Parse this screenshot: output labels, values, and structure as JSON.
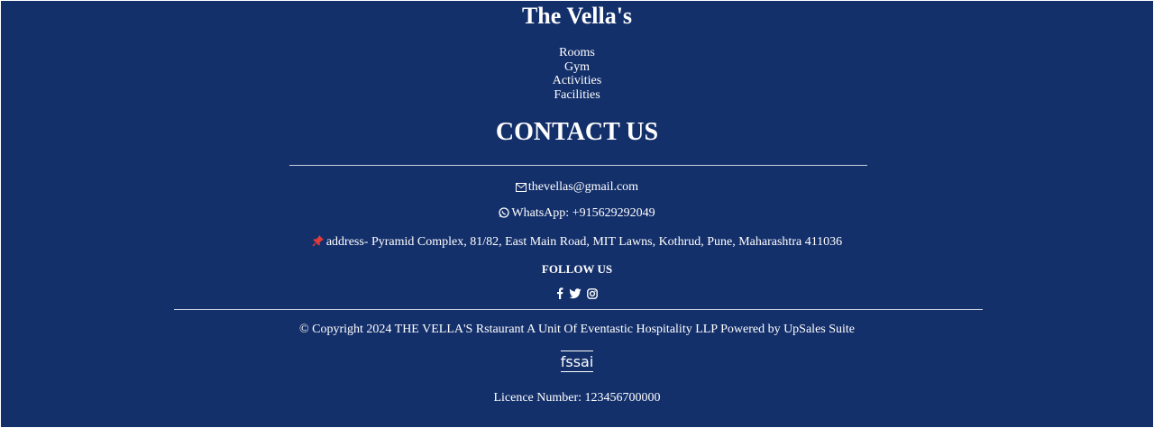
{
  "brand": {
    "name": "The Vella's"
  },
  "nav": {
    "items": [
      "Rooms",
      "Gym",
      "Activities",
      "Facilities"
    ]
  },
  "contact": {
    "title": "CONTACT US",
    "email": "thevellas@gmail.com",
    "whatsapp": "WhatsApp: +915629292049",
    "address": "address- Pyramid Complex, 81/82, East Main Road, MIT Lawns, Kothrud, Pune, Maharashtra 411036"
  },
  "social": {
    "title": "FOLLOW US",
    "icons": [
      "facebook-icon",
      "twitter-icon",
      "instagram-icon"
    ]
  },
  "copyright": "© Copyright 2024 THE VELLA'S Rstaurant A Unit Of Eventastic Hospitality LLP Powered by UpSales Suite",
  "fssai": {
    "logo_text": "fssai"
  },
  "licence": "Licence Number: 123456700000",
  "colors": {
    "background": "#14306b",
    "text": "#ffffff",
    "pin": "#e03b3b"
  }
}
